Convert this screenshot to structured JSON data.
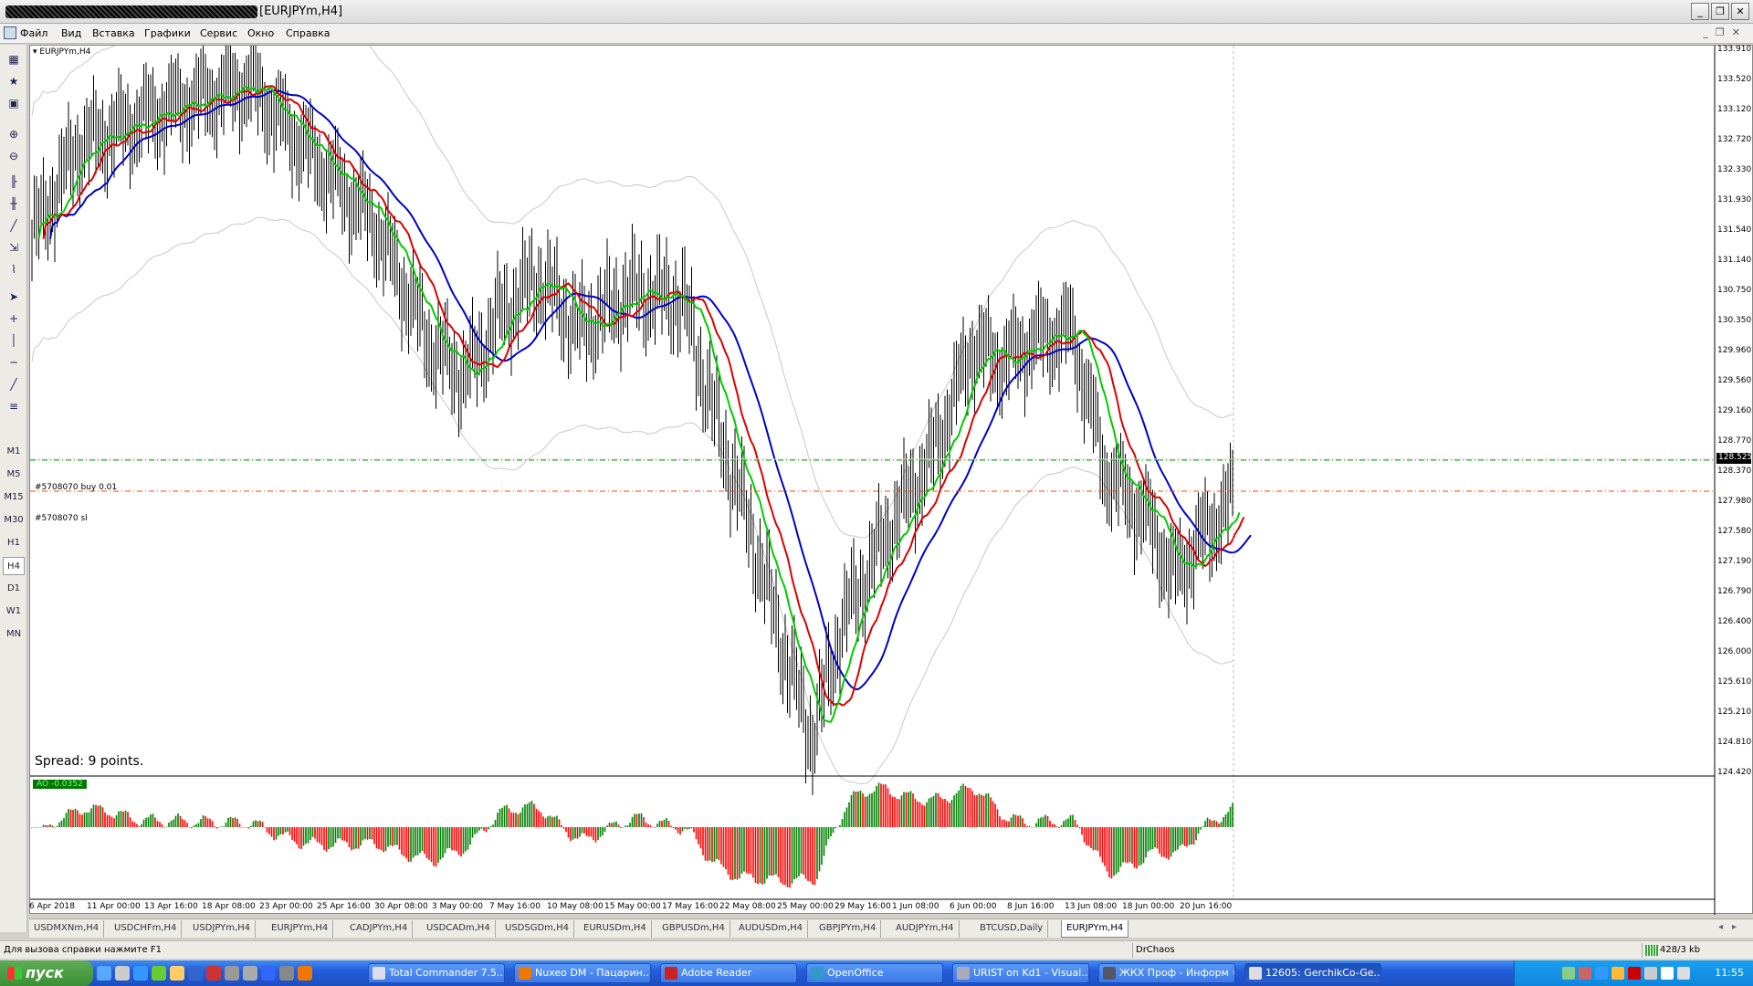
{
  "window": {
    "title": "[EURJPYm,H4]"
  },
  "menu": [
    "Файл",
    "Вид",
    "Вставка",
    "Графики",
    "Сервис",
    "Окно",
    "Справка"
  ],
  "toolbar": {
    "timeframes": [
      "M1",
      "M5",
      "M15",
      "M30",
      "H1",
      "H4",
      "D1",
      "W1",
      "MN"
    ],
    "active_timeframe": "H4"
  },
  "chart": {
    "symbol_label": "▾ EURJPYm,H4",
    "order_line_1": "#5708070 buy 0.01",
    "order_line_2": "#5708070 sl",
    "spread_text": "Spread: 9 points.",
    "current_price": "128.525",
    "ao_label": "AO -0.0352",
    "price_ticks": [
      "133.910",
      "133.520",
      "133.120",
      "132.720",
      "132.330",
      "131.930",
      "131.540",
      "131.140",
      "130.750",
      "130.350",
      "129.960",
      "129.560",
      "129.160",
      "128.770",
      "128.370",
      "127.980",
      "127.580",
      "127.190",
      "126.790",
      "126.400",
      "126.000",
      "125.610",
      "125.210",
      "124.810",
      "124.420"
    ],
    "time_ticks": [
      "6 Apr 2018",
      "11 Apr 00:00",
      "13 Apr 16:00",
      "18 Apr 08:00",
      "23 Apr 00:00",
      "25 Apr 16:00",
      "30 Apr 08:00",
      "3 May 00:00",
      "7 May 16:00",
      "10 May 08:00",
      "15 May 00:00",
      "17 May 16:00",
      "22 May 08:00",
      "25 May 00:00",
      "29 May 16:00",
      "1 Jun 08:00",
      "6 Jun 00:00",
      "8 Jun 16:00",
      "13 Jun 08:00",
      "18 Jun 00:00",
      "20 Jun 16:00"
    ]
  },
  "chart_data": {
    "type": "line",
    "title": "EURJPYm,H4",
    "ylim": [
      124.42,
      133.91
    ],
    "series": [
      {
        "name": "AO -0.0352",
        "values": []
      }
    ],
    "colors": {
      "blue": "#0000cc",
      "red": "#dd0000",
      "green": "#00cc00",
      "bands": "#c8c8c8",
      "ao_up": "#008000",
      "ao_down": "#ff0000"
    }
  },
  "tabs": [
    "USDMXNm,H4",
    "USDCHFm,H4",
    "USDJPYm,H4",
    "EURJPYm,H4",
    "CADJPYm,H4",
    "USDCADm,H4",
    "USDSGDm,H4",
    "EURUSDm,H4",
    "GBPUSDm,H4",
    "AUDUSDm,H4",
    "GBPJPYm,H4",
    "AUDJPYm,H4",
    "BTCUSD,Daily",
    "EURJPYm,H4"
  ],
  "active_tab_index": 13,
  "status": {
    "help": "Для вызова справки нажмите F1",
    "profile": "DrChaos",
    "connection": "428/3 kb"
  },
  "taskbar": {
    "start": "пуск",
    "items": [
      "Total Commander 7.5...",
      "Nuxeo DM - Пацарин...",
      "Adobe Reader",
      "OpenOffice",
      "URIST on Kd1 - Visual...",
      "ЖКХ Проф - Информ ©",
      "12605: GerchikCo-Ge..."
    ],
    "lang": "RU",
    "clock": "11:55"
  }
}
